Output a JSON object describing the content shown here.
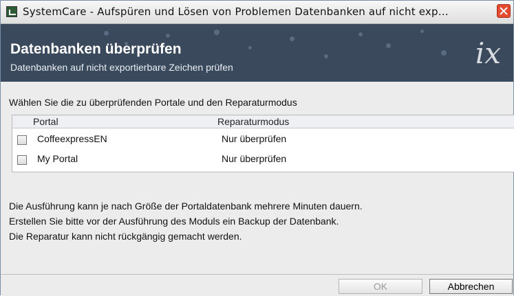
{
  "window": {
    "title": "SystemCare - Aufspüren und Lösen von Problemen Datenbanken auf nicht exp…"
  },
  "banner": {
    "title": "Datenbanken überprüfen",
    "subtitle": "Datenbanken auf nicht exportierbare Zeichen prüfen",
    "logo": "ix"
  },
  "instruction": "Wählen Sie die zu überprüfenden Portale und den Reparaturmodus",
  "table": {
    "headers": [
      "Portal",
      "Reparaturmodus"
    ],
    "rows": [
      {
        "portal": "CoffeexpressEN",
        "mode": "Nur überprüfen",
        "checked": false
      },
      {
        "portal": "My Portal",
        "mode": "Nur überprüfen",
        "checked": false
      }
    ]
  },
  "info_lines": [
    "Die Ausführung kann je nach Größe der Portaldatenbank mehrere Minuten dauern.",
    "Erstellen Sie bitte vor der Ausführung des Moduls ein Backup der Datenbank.",
    "Die Reparatur kann nicht rückgängig gemacht werden."
  ],
  "footer": {
    "ok_label": "OK",
    "cancel_label": "Abbrechen"
  }
}
